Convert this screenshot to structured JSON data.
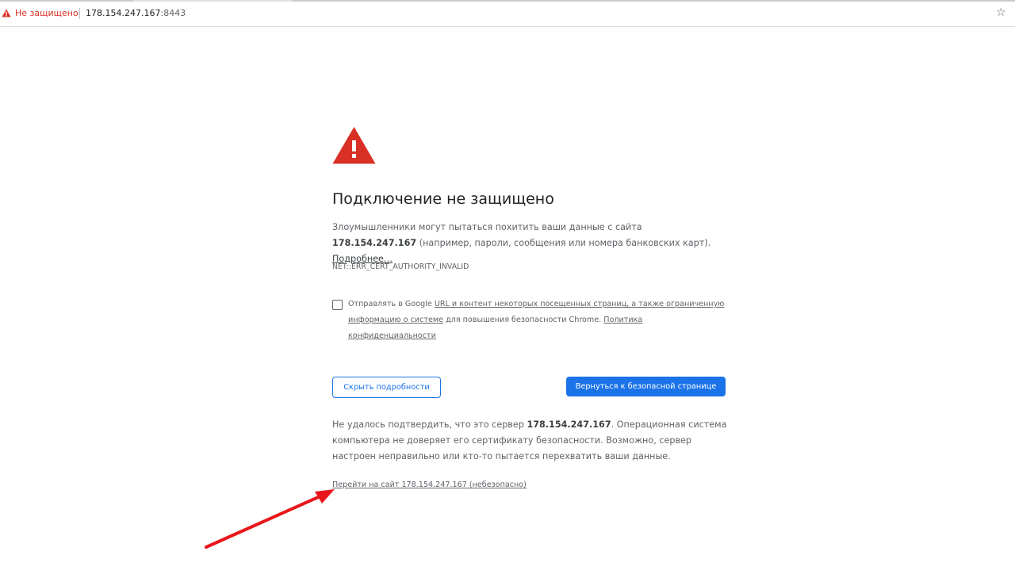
{
  "omnibox": {
    "security_label": "Не защищено",
    "url_host": "178.154.247.167",
    "url_port": ":8443"
  },
  "interstitial": {
    "title": "Подключение не защищено",
    "para1_prefix": "Злоумышленники могут пытаться похитить ваши данные с сайта ",
    "para1_host": "178.154.247.167",
    "para1_suffix": " (например, пароли, сообщения или номера банковских карт). ",
    "learn_more": "Подробнее…",
    "error_code": "NET::ERR_CERT_AUTHORITY_INVALID",
    "checkbox_prefix": "Отправлять в Google ",
    "checkbox_link1": "URL и контент некоторых посещенных страниц, а также ограниченную информацию о системе",
    "checkbox_middle": " для повышения безопасности Chrome. ",
    "checkbox_link2": "Политика конфиденциальности",
    "hide_details_button": "Скрыть подробности",
    "back_to_safety_button": "Вернуться к безопасной странице",
    "para2_prefix": "Не удалось подтвердить, что это сервер ",
    "para2_host": "178.154.247.167",
    "para2_suffix": ". Операционная система компьютера не доверяет его сертификату безопасности. Возможно, сервер настроен неправильно или кто-то пытается перехватить ваши данные.",
    "proceed_link": "Перейти на сайт 178.154.247.167 (небезопасно)"
  },
  "colors": {
    "warning_red": "#d93025",
    "accent_blue": "#1a73e8",
    "annotation_arrow": "#e8161b"
  },
  "icons": {
    "omnibox_warning": "warning-triangle-icon",
    "bookmark": "star-icon",
    "main_warning": "warning-triangle-icon"
  }
}
